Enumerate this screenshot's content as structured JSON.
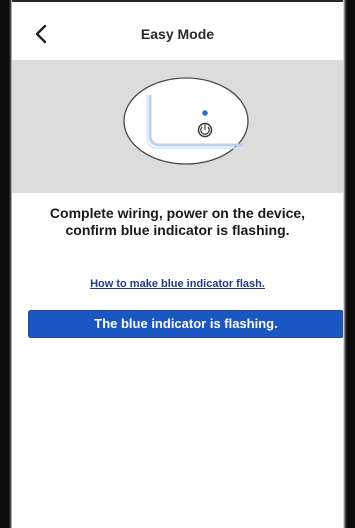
{
  "header": {
    "title": "Easy Mode",
    "back_icon": "chevron-left-icon"
  },
  "illustration": {
    "device": "wall-switch-device",
    "power_icon": "power-icon",
    "indicator_color": "#2a6fd6"
  },
  "main": {
    "instruction_line1": "Complete wiring, power on the device,",
    "instruction_line2": "confirm blue indicator is flashing.",
    "help_link": "How to make blue indicator flash.",
    "confirm_button": "The blue indicator is flashing."
  },
  "colors": {
    "accent": "#1a57c2",
    "link": "#1f3b8a",
    "hero_background": "#dcdcdc"
  }
}
